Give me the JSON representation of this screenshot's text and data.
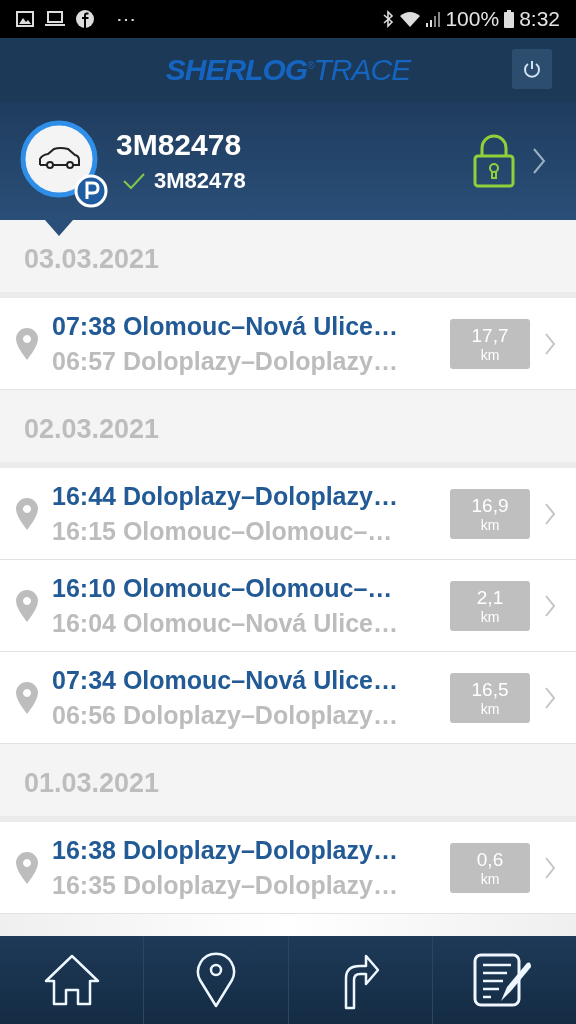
{
  "status_bar": {
    "more": "⋯",
    "battery": "100%",
    "time": "8:32"
  },
  "header": {
    "logo": "**SHERLOG**$^{®}$TRACE"
  },
  "vehicle": {
    "name": "3M82478",
    "subtitle": "3M82478",
    "parked": true,
    "locked": true
  },
  "days": [
    {
      "date": "03.03.2021",
      "trips": [
        {
          "arrival": "07:38 Olomouc–Nová Ulice…",
          "departure": "06:57 Doloplazy–Doloplazy…",
          "distance": "17,7",
          "unit": "km"
        }
      ]
    },
    {
      "date": "02.03.2021",
      "trips": [
        {
          "arrival": "16:44 Doloplazy–Doloplazy…",
          "departure": "16:15 Olomouc–Olomouc–…",
          "distance": "16,9",
          "unit": "km"
        },
        {
          "arrival": "16:10 Olomouc–Olomouc–…",
          "departure": "16:04 Olomouc–Nová Ulice…",
          "distance": "2,1",
          "unit": "km"
        },
        {
          "arrival": "07:34 Olomouc–Nová Ulice…",
          "departure": "06:56 Doloplazy–Doloplazy…",
          "distance": "16,5",
          "unit": "km"
        }
      ]
    },
    {
      "date": "01.03.2021",
      "trips": [
        {
          "arrival": "16:38 Doloplazy–Doloplazy…",
          "departure": "16:35 Doloplazy–Doloplazy…",
          "distance": "0,6",
          "unit": "km"
        }
      ]
    }
  ],
  "nav": [
    {
      "kind": "home"
    },
    {
      "kind": "place"
    },
    {
      "kind": "route"
    },
    {
      "kind": "notes"
    }
  ]
}
